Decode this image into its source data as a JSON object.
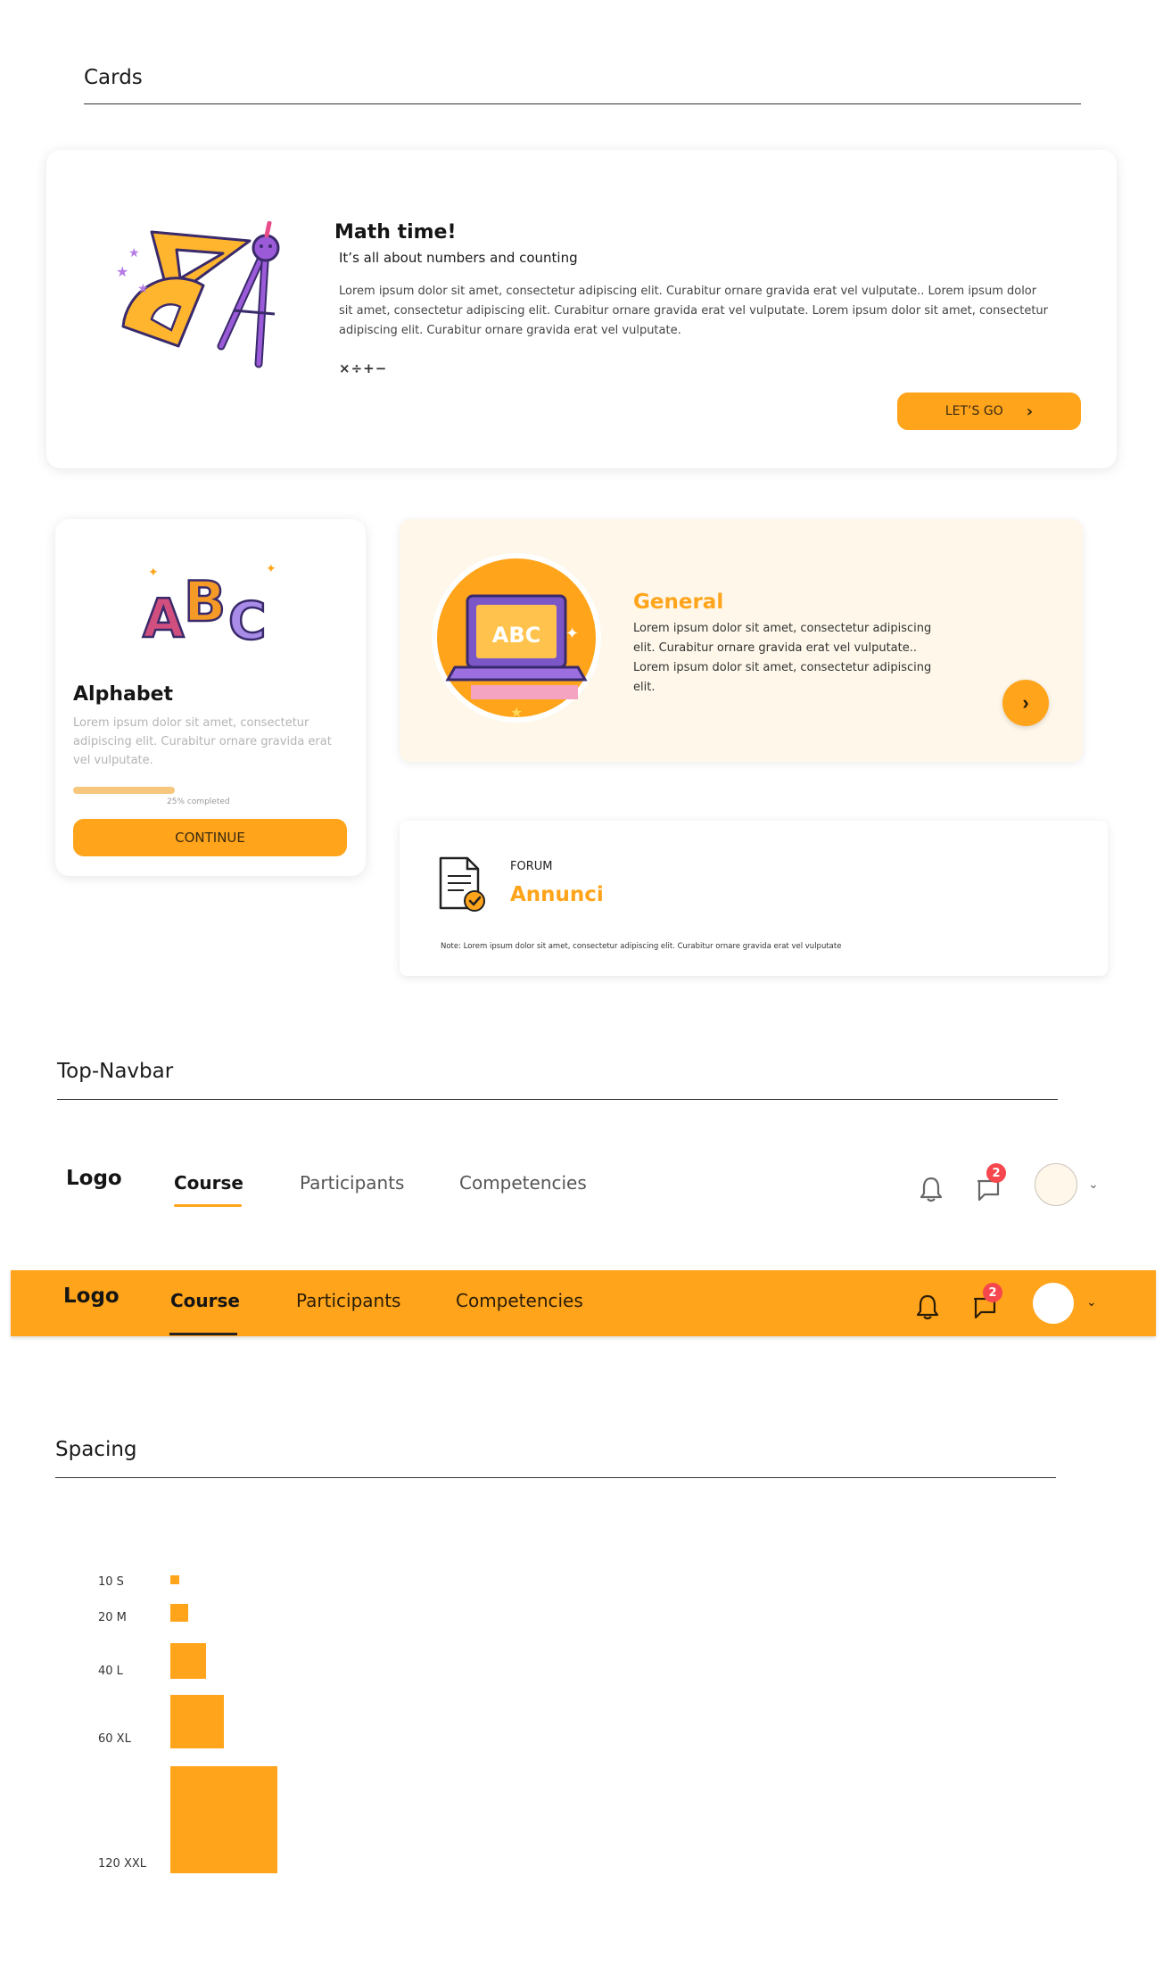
{
  "colors": {
    "accent": "#FFA41B",
    "soft_bg": "#FEF7EA",
    "badge": "#F5474D"
  },
  "cards_section": {
    "title": "Cards"
  },
  "math_card": {
    "title": "Math time!",
    "subtitle": "It’s all about numbers and counting",
    "body": "Lorem ipsum dolor sit amet, consectetur adipiscing elit. Curabitur ornare gravida erat vel vulputate.. Lorem ipsum dolor sit amet, consectetur adipiscing elit. Curabitur ornare gravida erat vel vulputate. Lorem ipsum dolor sit amet, consectetur adipiscing elit. Curabitur ornare gravida erat vel vulputate.",
    "symbols": "×÷+−",
    "button_label": "LET’S GO",
    "button_icon": "chevron-right-icon",
    "illustration": "geometry-tools-illustration"
  },
  "alphabet_card": {
    "illustration_text": "ABC",
    "title": "Alphabet",
    "body": "Lorem ipsum dolor sit amet, consectetur adipiscing elit. Curabitur ornare gravida erat vel vulputate.",
    "progress_percent": 25,
    "progress_label": "25% completed",
    "button_label": "CONTINUE"
  },
  "general_card": {
    "illustration_text": "ABC",
    "title": "General",
    "body": "Lorem ipsum dolor sit amet, consectetur adipiscing elit. Curabitur ornare gravida erat vel vulputate.. Lorem ipsum dolor sit amet, consectetur adipiscing elit.",
    "button_icon": "chevron-right-icon"
  },
  "forum_card": {
    "icon": "document-check-icon",
    "label": "FORUM",
    "title": "Annunci",
    "note": "Note: Lorem ipsum dolor sit amet, consectetur adipiscing elit. Curabitur ornare gravida erat vel vulputate"
  },
  "navbar_section": {
    "title": "Top-Navbar"
  },
  "navbar_light": {
    "logo": "Logo",
    "links": [
      "Course",
      "Participants",
      "Competencies"
    ],
    "active": "Course",
    "message_badge": "2"
  },
  "navbar_orange": {
    "logo": "Logo",
    "links": [
      "Course",
      "Participants",
      "Competencies"
    ],
    "active": "Course",
    "message_badge": "2"
  },
  "spacing_section": {
    "title": "Spacing",
    "items": [
      {
        "label": "10 S",
        "value": 10
      },
      {
        "label": "20 M",
        "value": 20
      },
      {
        "label": "40 L",
        "value": 40
      },
      {
        "label": "60 XL",
        "value": 60
      },
      {
        "label": "120 XXL",
        "value": 120
      }
    ]
  }
}
